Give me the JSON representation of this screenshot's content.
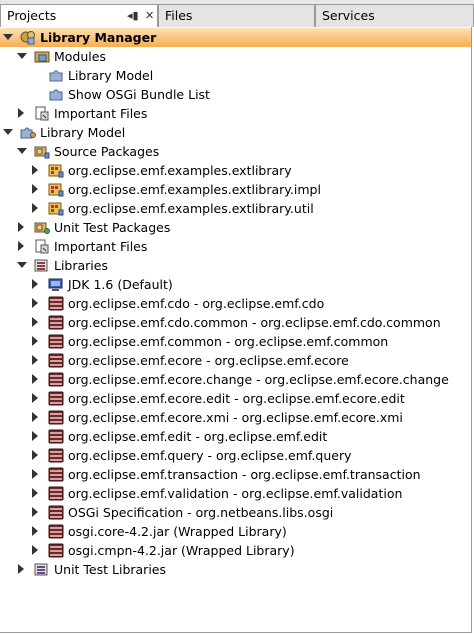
{
  "tabs": {
    "projects": "Projects",
    "files": "Files",
    "services": "Services",
    "minimize_glyph": "◂▮",
    "close_glyph": "✕"
  },
  "tree": [
    {
      "label": "Library Manager",
      "depth": 0,
      "toggle": "open",
      "icon": "module-suite-icon",
      "selected": true
    },
    {
      "label": "Modules",
      "depth": 1,
      "toggle": "open",
      "icon": "modules-folder-icon"
    },
    {
      "label": "Library Model",
      "depth": 2,
      "toggle": "none",
      "icon": "module-puzzle-icon"
    },
    {
      "label": "Show OSGi Bundle List",
      "depth": 2,
      "toggle": "none",
      "icon": "module-puzzle-icon"
    },
    {
      "label": "Important Files",
      "depth": 1,
      "toggle": "closed",
      "icon": "important-files-icon"
    },
    {
      "label": "Library Model",
      "depth": 0,
      "toggle": "open",
      "icon": "module-project-icon"
    },
    {
      "label": "Source Packages",
      "depth": 1,
      "toggle": "open",
      "icon": "source-packages-icon"
    },
    {
      "label": "org.eclipse.emf.examples.extlibrary",
      "depth": 2,
      "toggle": "closed",
      "icon": "package-icon"
    },
    {
      "label": "org.eclipse.emf.examples.extlibrary.impl",
      "depth": 2,
      "toggle": "closed",
      "icon": "package-icon"
    },
    {
      "label": "org.eclipse.emf.examples.extlibrary.util",
      "depth": 2,
      "toggle": "closed",
      "icon": "package-icon"
    },
    {
      "label": "Unit Test Packages",
      "depth": 1,
      "toggle": "closed",
      "icon": "test-packages-icon"
    },
    {
      "label": "Important Files",
      "depth": 1,
      "toggle": "closed",
      "icon": "important-files-icon"
    },
    {
      "label": "Libraries",
      "depth": 1,
      "toggle": "open",
      "icon": "libraries-icon"
    },
    {
      "label": "JDK 1.6 (Default)",
      "depth": 2,
      "toggle": "closed",
      "icon": "jdk-icon"
    },
    {
      "label": "org.eclipse.emf.cdo - org.eclipse.emf.cdo",
      "depth": 2,
      "toggle": "closed",
      "icon": "jar-icon"
    },
    {
      "label": "org.eclipse.emf.cdo.common - org.eclipse.emf.cdo.common",
      "depth": 2,
      "toggle": "closed",
      "icon": "jar-icon"
    },
    {
      "label": "org.eclipse.emf.common - org.eclipse.emf.common",
      "depth": 2,
      "toggle": "closed",
      "icon": "jar-icon"
    },
    {
      "label": "org.eclipse.emf.ecore - org.eclipse.emf.ecore",
      "depth": 2,
      "toggle": "closed",
      "icon": "jar-icon"
    },
    {
      "label": "org.eclipse.emf.ecore.change - org.eclipse.emf.ecore.change",
      "depth": 2,
      "toggle": "closed",
      "icon": "jar-icon"
    },
    {
      "label": "org.eclipse.emf.ecore.edit - org.eclipse.emf.ecore.edit",
      "depth": 2,
      "toggle": "closed",
      "icon": "jar-icon"
    },
    {
      "label": "org.eclipse.emf.ecore.xmi - org.eclipse.emf.ecore.xmi",
      "depth": 2,
      "toggle": "closed",
      "icon": "jar-icon"
    },
    {
      "label": "org.eclipse.emf.edit - org.eclipse.emf.edit",
      "depth": 2,
      "toggle": "closed",
      "icon": "jar-icon"
    },
    {
      "label": "org.eclipse.emf.query - org.eclipse.emf.query",
      "depth": 2,
      "toggle": "closed",
      "icon": "jar-icon"
    },
    {
      "label": "org.eclipse.emf.transaction - org.eclipse.emf.transaction",
      "depth": 2,
      "toggle": "closed",
      "icon": "jar-icon"
    },
    {
      "label": "org.eclipse.emf.validation - org.eclipse.emf.validation",
      "depth": 2,
      "toggle": "closed",
      "icon": "jar-icon"
    },
    {
      "label": "OSGi Specification - org.netbeans.libs.osgi",
      "depth": 2,
      "toggle": "closed",
      "icon": "jar-icon"
    },
    {
      "label": "osgi.core-4.2.jar (Wrapped Library)",
      "depth": 2,
      "toggle": "closed",
      "icon": "jar-icon"
    },
    {
      "label": "osgi.cmpn-4.2.jar (Wrapped Library)",
      "depth": 2,
      "toggle": "closed",
      "icon": "jar-icon"
    },
    {
      "label": "Unit Test Libraries",
      "depth": 1,
      "toggle": "closed",
      "icon": "test-libraries-icon"
    }
  ]
}
